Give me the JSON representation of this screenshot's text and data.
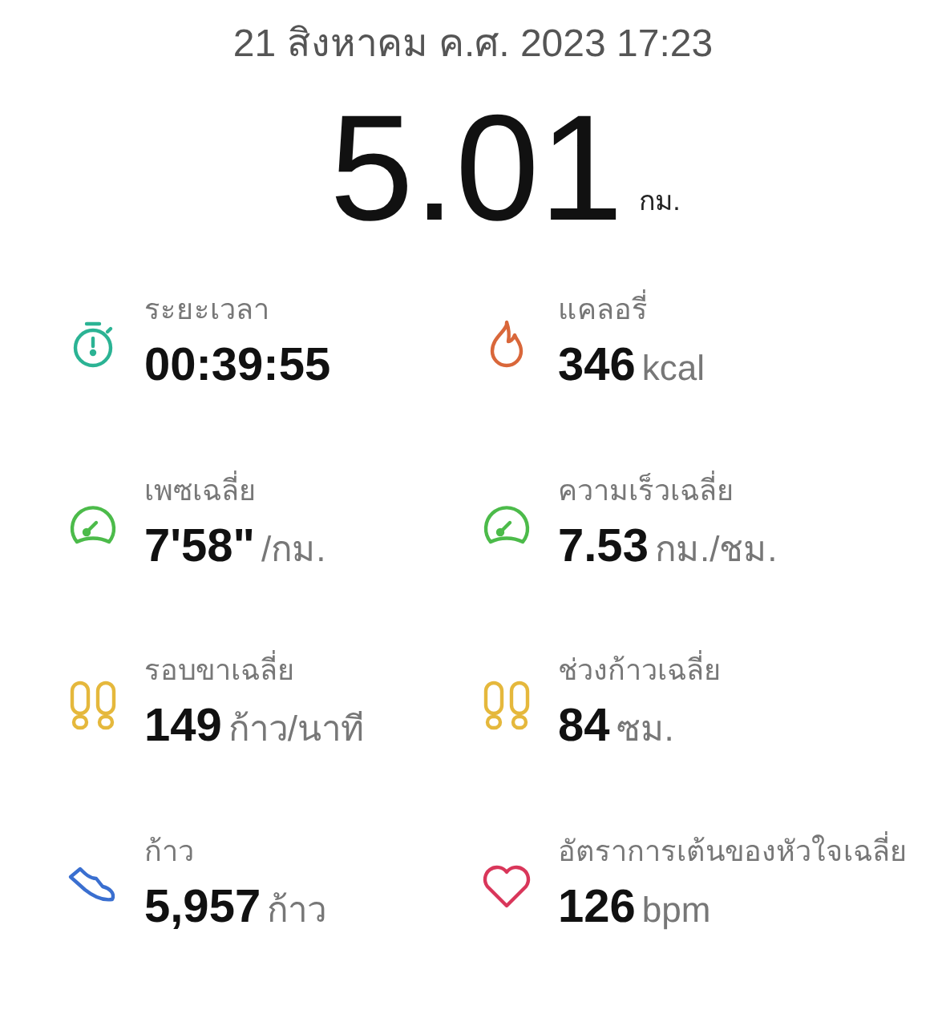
{
  "date": "21 สิงหาคม ค.ศ. 2023 17:23",
  "distance": {
    "value": "5.01",
    "unit": "กม."
  },
  "stats": [
    {
      "kind": "stopwatch",
      "color": "#2bb394",
      "label": "ระยะเวลา",
      "value": "00:39:55"
    },
    {
      "kind": "flame",
      "color": "#d9673a",
      "label": "แคลอรี่",
      "value": "346",
      "unit": "kcal"
    },
    {
      "kind": "gauge",
      "color": "#4cbb4a",
      "label": "เพซเฉลี่ย",
      "value": "7'58\"",
      "unit": "/กม."
    },
    {
      "kind": "gauge",
      "color": "#4cbb4a",
      "label": "ความเร็วเฉลี่ย",
      "value": "7.53",
      "unit": "กม./ชม."
    },
    {
      "kind": "footprints",
      "color": "#e5b83c",
      "label": "รอบขาเฉลี่ย",
      "value": "149",
      "unit": "ก้าว/นาที"
    },
    {
      "kind": "footprints",
      "color": "#e5b83c",
      "label": "ช่วงก้าวเฉลี่ย",
      "value": "84",
      "unit": "ซม."
    },
    {
      "kind": "shoe",
      "color": "#3a6fd0",
      "label": "ก้าว",
      "value": "5,957",
      "unit": "ก้าว"
    },
    {
      "kind": "heart",
      "color": "#d9365a",
      "label": "อัตราการเต้นของหัวใจเฉลี่ย",
      "value": "126",
      "unit": "bpm"
    }
  ]
}
